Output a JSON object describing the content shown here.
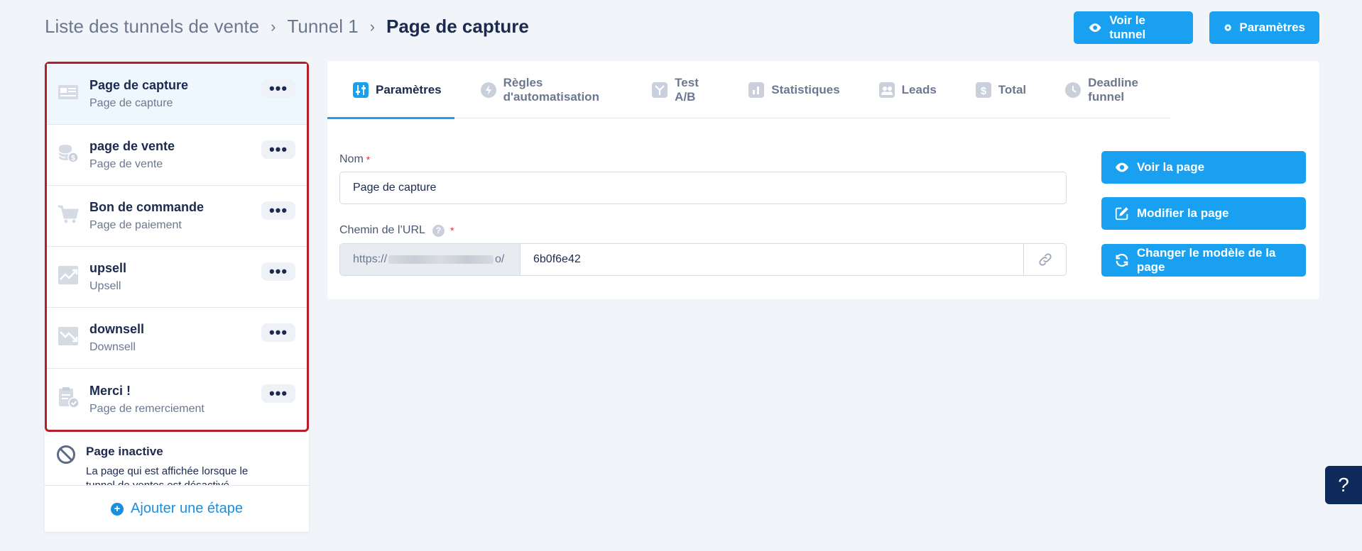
{
  "breadcrumb": {
    "item1": "Liste des tunnels de vente",
    "item2": "Tunnel 1",
    "current": "Page de capture",
    "separator": "›"
  },
  "header_buttons": {
    "view_funnel": "Voir le tunnel",
    "settings": "Paramètres"
  },
  "steps": [
    {
      "title": "Page de capture",
      "subtitle": "Page de capture",
      "icon": "form-page-icon"
    },
    {
      "title": "page de vente",
      "subtitle": "Page de vente",
      "icon": "coins-icon"
    },
    {
      "title": "Bon de commande",
      "subtitle": "Page de paiement",
      "icon": "cart-icon"
    },
    {
      "title": "upsell",
      "subtitle": "Upsell",
      "icon": "trend-up-icon"
    },
    {
      "title": "downsell",
      "subtitle": "Downsell",
      "icon": "trend-down-icon"
    },
    {
      "title": "Merci !",
      "subtitle": "Page de remerciement",
      "icon": "clipboard-check-icon"
    }
  ],
  "more_label": "•••",
  "inactive": {
    "title": "Page inactive",
    "description": "La page qui est affichée lorsque le tunnel de ventes est désactivé"
  },
  "add_step": "Ajouter une étape",
  "tabs": [
    {
      "label": "Paramètres",
      "icon": "sliders-icon"
    },
    {
      "label": "Règles d'automatisation",
      "icon": "bolt-icon"
    },
    {
      "label": "Test A/B",
      "icon": "split-icon"
    },
    {
      "label": "Statistiques",
      "icon": "bar-chart-icon"
    },
    {
      "label": "Leads",
      "icon": "users-icon"
    },
    {
      "label": "Total",
      "icon": "dollar-icon"
    },
    {
      "label": "Deadline funnel",
      "icon": "clock-icon"
    }
  ],
  "form": {
    "name_label": "Nom",
    "name_value": "Page de capture",
    "url_label": "Chemin de l’URL",
    "url_prefix_start": "https://",
    "url_prefix_end": "o/",
    "url_value": "6b0f6e42",
    "required_mark": "*",
    "help_mark": "?"
  },
  "actions": {
    "view_page": "Voir la page",
    "edit_page": "Modifier la page",
    "change_template": "Changer le modèle de la page"
  },
  "help_fab": "?",
  "colors": {
    "accent": "#1aa0f0",
    "highlight_border": "#b51f2a",
    "background": "#f1f4f8"
  }
}
